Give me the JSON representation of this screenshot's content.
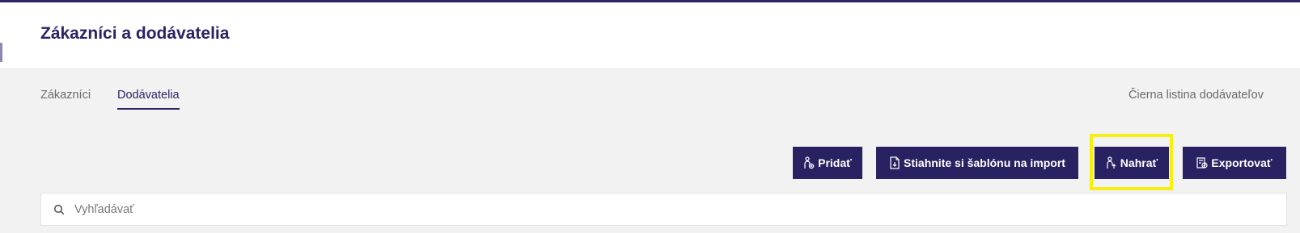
{
  "header": {
    "title": "Zákazníci a dodávatelia"
  },
  "tabs": [
    {
      "label": "Zákazníci",
      "active": false
    },
    {
      "label": "Dodávatelia",
      "active": true
    }
  ],
  "links": {
    "blacklist": "Čierna listina dodávateľov"
  },
  "toolbar": {
    "add_label": "Pridať",
    "download_template_label": "Stiahnite si šablónu na import",
    "upload_label": "Nahrať",
    "export_label": "Exportovať"
  },
  "search": {
    "placeholder": "Vyhľadávať",
    "value": ""
  },
  "colors": {
    "primary": "#282262",
    "title": "#2b2466",
    "background": "#f2f2f2",
    "highlight": "#f7ef12"
  },
  "icons": {
    "add": "person-plus-icon",
    "download_template": "document-download-icon",
    "upload": "person-upload-icon",
    "export": "export-document-icon",
    "search": "search-icon"
  }
}
